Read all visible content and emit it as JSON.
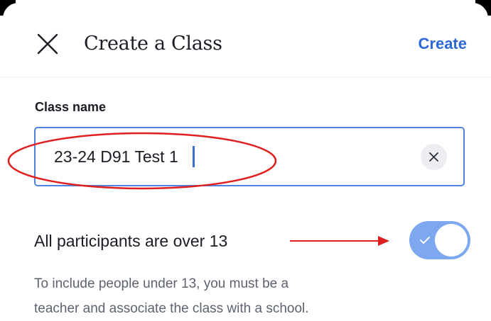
{
  "header": {
    "title": "Create a Class",
    "action_label": "Create"
  },
  "class_name": {
    "label": "Class name",
    "value": "23-24 D91 Test 1"
  },
  "participants": {
    "label": "All participants are over 13",
    "enabled": true
  },
  "helper_text": {
    "line1": "To include people under 13, you must be a",
    "line2": "teacher and associate the class with a school."
  },
  "icons": {
    "close": "close-icon",
    "clear": "clear-icon",
    "check": "check-icon"
  },
  "colors": {
    "accent": "#2d68d6",
    "input_border": "#4f83df",
    "toggle_on": "#7da7ef",
    "annotation": "#e01f1f"
  }
}
